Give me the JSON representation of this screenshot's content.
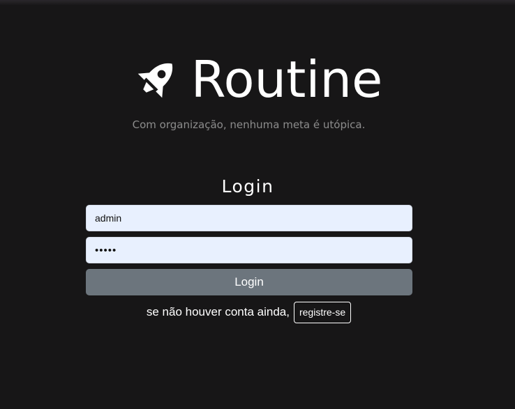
{
  "brand": {
    "title": "Routine",
    "icon": "rocket-icon",
    "tagline": "Com organização, nenhuma meta é utópica."
  },
  "login": {
    "title": "Login",
    "username_value": "admin",
    "password_value": "admin",
    "submit_label": "Login"
  },
  "register": {
    "prompt": "se não houver conta ainda,",
    "button_label": "registre-se"
  },
  "colors": {
    "background": "#171617",
    "input_background": "#e8f0fe",
    "button_background": "#6c757d",
    "tagline": "#8c8c8c"
  }
}
